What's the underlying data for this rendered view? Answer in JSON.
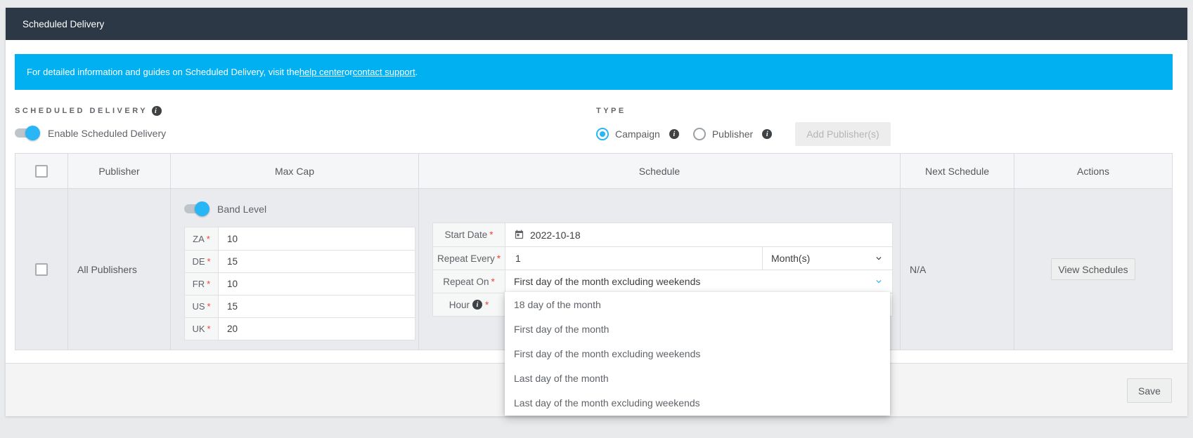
{
  "header": {
    "title": "Scheduled Delivery"
  },
  "banner": {
    "text_before": "For detailed information and guides on Scheduled Delivery, visit the ",
    "help_link": "help center",
    "or_text": " or ",
    "support_link": "contact support",
    "period": "."
  },
  "scheduled_delivery": {
    "heading": "SCHEDULED DELIVERY",
    "enable_label": "Enable Scheduled Delivery",
    "enabled": true
  },
  "type_section": {
    "heading": "TYPE",
    "campaign_label": "Campaign",
    "publisher_label": "Publisher",
    "campaign_selected": true,
    "add_publishers_label": "Add Publisher(s)"
  },
  "table": {
    "columns": {
      "publisher": "Publisher",
      "max_cap": "Max Cap",
      "schedule": "Schedule",
      "next_schedule": "Next Schedule",
      "actions": "Actions"
    },
    "row": {
      "publisher": "All Publishers",
      "band_level_label": "Band Level",
      "band_level_on": true,
      "caps": [
        {
          "code": "ZA",
          "value": "10"
        },
        {
          "code": "DE",
          "value": "15"
        },
        {
          "code": "FR",
          "value": "10"
        },
        {
          "code": "US",
          "value": "15"
        },
        {
          "code": "UK",
          "value": "20"
        }
      ],
      "schedule": {
        "start_date_label": "Start Date",
        "start_date_value": "2022-10-18",
        "repeat_every_label": "Repeat Every",
        "repeat_every_value": "1",
        "repeat_unit": "Month(s)",
        "repeat_on_label": "Repeat On",
        "repeat_on_value": "First day of the month excluding weekends",
        "hour_label": "Hour"
      },
      "next_schedule": "N/A",
      "view_schedules_label": "View Schedules"
    }
  },
  "repeat_on_dropdown": {
    "options": [
      "18 day of the month",
      "First day of the month",
      "First day of the month excluding weekends",
      "Last day of the month",
      "Last day of the month excluding weekends"
    ]
  },
  "footer": {
    "save_label": "Save"
  },
  "misc": {
    "required_mark": "*",
    "info_glyph": "i"
  },
  "colors": {
    "accent_blue": "#29b6f6",
    "banner_blue": "#00b0f0",
    "header_dark": "#2c3845",
    "required_red": "#f44336",
    "row_bg": "#e9ebee"
  }
}
